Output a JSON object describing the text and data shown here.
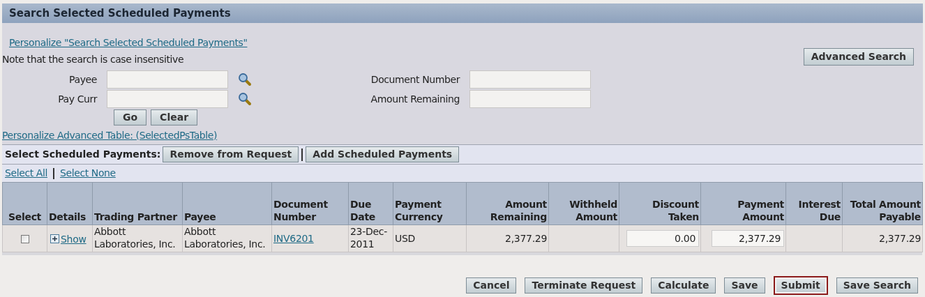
{
  "header": {
    "title": "Search Selected Scheduled Payments"
  },
  "search": {
    "personalize_link": "Personalize \"Search Selected Scheduled Payments\"",
    "note": "Note that the search is case insensitive",
    "advanced_button": "Advanced Search",
    "left_fields": [
      {
        "label": "Payee"
      },
      {
        "label": "Pay Curr"
      }
    ],
    "right_fields": [
      {
        "label": "Document Number"
      },
      {
        "label": "Amount Remaining"
      }
    ],
    "buttons": [
      "Go",
      "Clear"
    ]
  },
  "table_personalize_link": "Personalize Advanced Table: (SelectedPsTable)",
  "toolbar": {
    "label": "Select Scheduled Payments:",
    "buttons": [
      "Remove from Request",
      "Add Scheduled Payments"
    ]
  },
  "selection_links": [
    "Select All",
    "Select None"
  ],
  "table": {
    "columns": [
      "Select",
      "Details",
      "Trading Partner",
      "Payee",
      "Document Number",
      "Due Date",
      "Payment Currency",
      "Amount Remaining",
      "Withheld Amount",
      "Discount Taken",
      "Payment Amount",
      "Interest Due",
      "Total Amount Payable"
    ],
    "rows": [
      {
        "checked": false,
        "details_link": "Show",
        "trading_partner": "Abbott Laboratories, Inc.",
        "payee": "Abbott Laboratories, Inc.",
        "document_number": "INV6201",
        "due_date": "23-Dec-2011",
        "payment_currency": "USD",
        "amount_remaining": "2,377.29",
        "discount_taken": "0.00",
        "payment_amount": "2,377.29",
        "total_amount_payable": "2,377.29"
      }
    ]
  },
  "footer_buttons": [
    {
      "label": "Cancel",
      "focused": false
    },
    {
      "label": "Terminate Request",
      "focused": false
    },
    {
      "label": "Calculate",
      "focused": false
    },
    {
      "label": "Save",
      "focused": false
    },
    {
      "label": "Submit",
      "focused": true
    },
    {
      "label": "Save Search",
      "focused": false
    }
  ]
}
